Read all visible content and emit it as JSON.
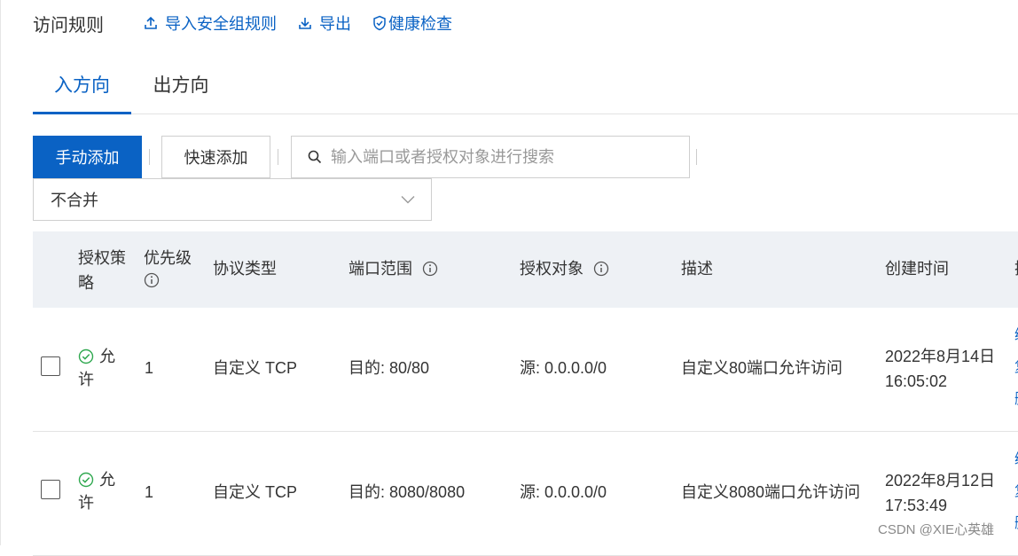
{
  "header": {
    "title": "访问规则",
    "import_label": "导入安全组规则",
    "export_label": "导出",
    "health_label": "健康检查"
  },
  "tabs": [
    {
      "label": "入方向",
      "active": true
    },
    {
      "label": "出方向",
      "active": false
    }
  ],
  "toolbar": {
    "manual_add": "手动添加",
    "quick_add": "快速添加",
    "search_placeholder": "输入端口或者授权对象进行搜索",
    "merge_select": "不合并"
  },
  "table": {
    "columns": {
      "policy_line1": "授权策",
      "policy_line2": "略",
      "priority": "优先级",
      "protocol": "协议类型",
      "port": "端口范围",
      "object": "授权对象",
      "description": "描述",
      "created": "创建时间"
    },
    "rows": [
      {
        "policy_line1": "允",
        "policy_line2": "许",
        "priority": "1",
        "protocol": "自定义 TCP",
        "port": "目的: 80/80",
        "object": "源: 0.0.0.0/0",
        "description": "自定义80端口允许访问",
        "created_date": "2022年8月14日",
        "created_time": "16:05:02"
      },
      {
        "policy_line1": "允",
        "policy_line2": "许",
        "priority": "1",
        "protocol": "自定义 TCP",
        "port": "目的: 8080/8080",
        "object": "源: 0.0.0.0/0",
        "description": "自定义8080端口允许访问",
        "created_date": "2022年8月12日",
        "created_time": "17:53:49"
      }
    ]
  },
  "watermark": "CSDN @XIE心英雄",
  "colors": {
    "accent": "#0a62c4",
    "header_bg": "#eef1f5",
    "allow_green": "#2fa84f"
  },
  "icons": {
    "import": "upload-icon",
    "export": "download-icon",
    "health": "shield-check-icon",
    "search": "search-icon",
    "select": "chevron-down-icon",
    "info": "info-icon",
    "allow": "check-circle-icon"
  }
}
